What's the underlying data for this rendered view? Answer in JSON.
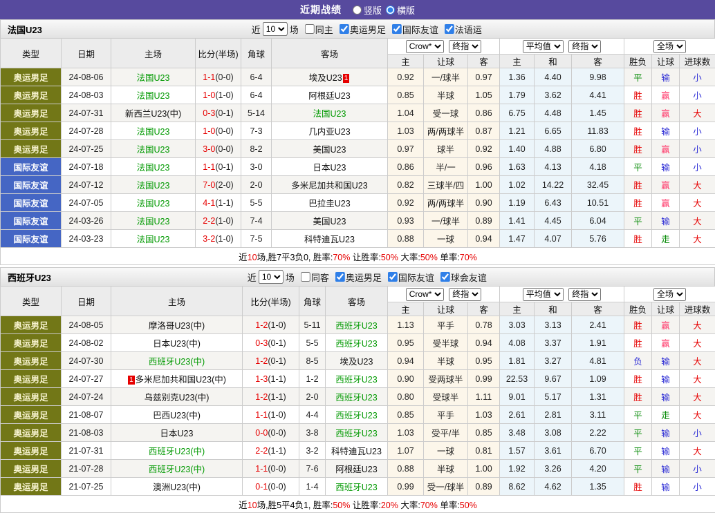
{
  "topbar": {
    "title": "近期战绩",
    "vertical_label": "竖版",
    "horizontal_label": "横版"
  },
  "colors": {
    "header_purple": "#574a9e",
    "type_olympic_olive": "#727717",
    "type_friendly_blue": "#4566c4",
    "team_green": "#009900",
    "win_red": "#e60000",
    "handicap_win_pink": "#ff3366",
    "lose_blue": "#2b2bd5",
    "draw_green": "#008800"
  },
  "sections": [
    {
      "team": "法国U23",
      "filter": {
        "near": "近",
        "games": "10",
        "unit": "场",
        "same": "同主",
        "types": [
          "奥运男足",
          "国际友谊",
          "法语运"
        ]
      },
      "selects": {
        "odds": "Crow*",
        "odds_final": "终指",
        "avg": "平均值",
        "avg_final": "终指",
        "scope": "全场"
      },
      "columns": [
        "类型",
        "日期",
        "主场",
        "比分(半场)",
        "角球",
        "客场",
        "主",
        "让球",
        "客",
        "主",
        "和",
        "客",
        "胜负",
        "让球",
        "进球数"
      ],
      "rows": [
        {
          "t": "奥运男足",
          "tc": "olive",
          "d": "24-08-06",
          "h": "法国U23",
          "hg": true,
          "hb": "",
          "s": "1-1",
          "sh": "(0-0)",
          "c": "6-4",
          "a": "埃及U23",
          "ag": false,
          "ab": "1",
          "o1": "0.92",
          "hc": "一/球半",
          "o2": "0.97",
          "v1": "1.36",
          "v2": "4.40",
          "v3": "9.98",
          "r1": [
            "平",
            "g"
          ],
          "r2": [
            "输",
            "b"
          ],
          "r3": [
            "小",
            "b"
          ]
        },
        {
          "t": "奥运男足",
          "tc": "olive",
          "d": "24-08-03",
          "h": "法国U23",
          "hg": true,
          "hb": "",
          "s": "1-0",
          "sh": "(1-0)",
          "c": "6-4",
          "a": "阿根廷U23",
          "ag": false,
          "ab": "",
          "o1": "0.85",
          "hc": "半球",
          "o2": "1.05",
          "v1": "1.79",
          "v2": "3.62",
          "v3": "4.41",
          "r1": [
            "胜",
            "r"
          ],
          "r2": [
            "赢",
            "p"
          ],
          "r3": [
            "小",
            "b"
          ]
        },
        {
          "t": "奥运男足",
          "tc": "olive",
          "d": "24-07-31",
          "h": "新西兰U23(中)",
          "hg": false,
          "hb": "",
          "s": "0-3",
          "sh": "(0-1)",
          "c": "5-14",
          "a": "法国U23",
          "ag": true,
          "ab": "",
          "o1": "1.04",
          "hc": "受一球",
          "o2": "0.86",
          "v1": "6.75",
          "v2": "4.48",
          "v3": "1.45",
          "r1": [
            "胜",
            "r"
          ],
          "r2": [
            "赢",
            "p"
          ],
          "r3": [
            "大",
            "r"
          ]
        },
        {
          "t": "奥运男足",
          "tc": "olive",
          "d": "24-07-28",
          "h": "法国U23",
          "hg": true,
          "hb": "",
          "s": "1-0",
          "sh": "(0-0)",
          "c": "7-3",
          "a": "几内亚U23",
          "ag": false,
          "ab": "",
          "o1": "1.03",
          "hc": "两/两球半",
          "o2": "0.87",
          "v1": "1.21",
          "v2": "6.65",
          "v3": "11.83",
          "r1": [
            "胜",
            "r"
          ],
          "r2": [
            "输",
            "b"
          ],
          "r3": [
            "小",
            "b"
          ]
        },
        {
          "t": "奥运男足",
          "tc": "olive",
          "d": "24-07-25",
          "h": "法国U23",
          "hg": true,
          "hb": "",
          "s": "3-0",
          "sh": "(0-0)",
          "c": "8-2",
          "a": "美国U23",
          "ag": false,
          "ab": "",
          "o1": "0.97",
          "hc": "球半",
          "o2": "0.92",
          "v1": "1.40",
          "v2": "4.88",
          "v3": "6.80",
          "r1": [
            "胜",
            "r"
          ],
          "r2": [
            "赢",
            "p"
          ],
          "r3": [
            "小",
            "b"
          ]
        },
        {
          "t": "国际友谊",
          "tc": "blue",
          "d": "24-07-18",
          "h": "法国U23",
          "hg": true,
          "hb": "",
          "s": "1-1",
          "sh": "(0-1)",
          "c": "3-0",
          "a": "日本U23",
          "ag": false,
          "ab": "",
          "o1": "0.86",
          "hc": "半/一",
          "o2": "0.96",
          "v1": "1.63",
          "v2": "4.13",
          "v3": "4.18",
          "r1": [
            "平",
            "g"
          ],
          "r2": [
            "输",
            "b"
          ],
          "r3": [
            "小",
            "b"
          ]
        },
        {
          "t": "国际友谊",
          "tc": "blue",
          "d": "24-07-12",
          "h": "法国U23",
          "hg": true,
          "hb": "",
          "s": "7-0",
          "sh": "(2-0)",
          "c": "2-0",
          "a": "多米尼加共和国U23",
          "ag": false,
          "ab": "",
          "o1": "0.82",
          "hc": "三球半/四",
          "o2": "1.00",
          "v1": "1.02",
          "v2": "14.22",
          "v3": "32.45",
          "r1": [
            "胜",
            "r"
          ],
          "r2": [
            "赢",
            "p"
          ],
          "r3": [
            "大",
            "r"
          ]
        },
        {
          "t": "国际友谊",
          "tc": "blue",
          "d": "24-07-05",
          "h": "法国U23",
          "hg": true,
          "hb": "",
          "s": "4-1",
          "sh": "(1-1)",
          "c": "5-5",
          "a": "巴拉圭U23",
          "ag": false,
          "ab": "",
          "o1": "0.92",
          "hc": "两/两球半",
          "o2": "0.90",
          "v1": "1.19",
          "v2": "6.43",
          "v3": "10.51",
          "r1": [
            "胜",
            "r"
          ],
          "r2": [
            "赢",
            "p"
          ],
          "r3": [
            "大",
            "r"
          ]
        },
        {
          "t": "国际友谊",
          "tc": "blue",
          "d": "24-03-26",
          "h": "法国U23",
          "hg": true,
          "hb": "",
          "s": "2-2",
          "sh": "(1-0)",
          "c": "7-4",
          "a": "美国U23",
          "ag": false,
          "ab": "",
          "o1": "0.93",
          "hc": "一/球半",
          "o2": "0.89",
          "v1": "1.41",
          "v2": "4.45",
          "v3": "6.04",
          "r1": [
            "平",
            "g"
          ],
          "r2": [
            "输",
            "b"
          ],
          "r3": [
            "大",
            "r"
          ]
        },
        {
          "t": "国际友谊",
          "tc": "blue",
          "d": "24-03-23",
          "h": "法国U23",
          "hg": true,
          "hb": "",
          "s": "3-2",
          "sh": "(1-0)",
          "c": "7-5",
          "a": "科特迪瓦U23",
          "ag": false,
          "ab": "",
          "o1": "0.88",
          "hc": "一球",
          "o2": "0.94",
          "v1": "1.47",
          "v2": "4.07",
          "v3": "5.76",
          "r1": [
            "胜",
            "r"
          ],
          "r2": [
            "走",
            "g"
          ],
          "r3": [
            "大",
            "r"
          ]
        }
      ],
      "summary": [
        [
          "近",
          "k"
        ],
        [
          "10",
          "r"
        ],
        [
          "场,胜7平3负0, 胜率:",
          "k"
        ],
        [
          "70%",
          "r"
        ],
        [
          " 让胜率:",
          "k"
        ],
        [
          "50%",
          "r"
        ],
        [
          " 大率:",
          "k"
        ],
        [
          "50%",
          "r"
        ],
        [
          " 单率:",
          "k"
        ],
        [
          "70%",
          "r"
        ]
      ]
    },
    {
      "team": "西班牙U23",
      "filter": {
        "near": "近",
        "games": "10",
        "unit": "场",
        "same": "同客",
        "types": [
          "奥运男足",
          "国际友谊",
          "球会友谊"
        ]
      },
      "selects": {
        "odds": "Crow*",
        "odds_final": "终指",
        "avg": "平均值",
        "avg_final": "终指",
        "scope": "全场"
      },
      "columns": [
        "类型",
        "日期",
        "主场",
        "比分(半场)",
        "角球",
        "客场",
        "主",
        "让球",
        "客",
        "主",
        "和",
        "客",
        "胜负",
        "让球",
        "进球数"
      ],
      "rows": [
        {
          "t": "奥运男足",
          "tc": "olive",
          "d": "24-08-05",
          "h": "摩洛哥U23(中)",
          "hg": false,
          "hb": "",
          "s": "1-2",
          "sh": "(1-0)",
          "c": "5-11",
          "a": "西班牙U23",
          "ag": true,
          "ab": "",
          "o1": "1.13",
          "hc": "平手",
          "o2": "0.78",
          "v1": "3.03",
          "v2": "3.13",
          "v3": "2.41",
          "r1": [
            "胜",
            "r"
          ],
          "r2": [
            "赢",
            "p"
          ],
          "r3": [
            "大",
            "r"
          ]
        },
        {
          "t": "奥运男足",
          "tc": "olive",
          "d": "24-08-02",
          "h": "日本U23(中)",
          "hg": false,
          "hb": "",
          "s": "0-3",
          "sh": "(0-1)",
          "c": "5-5",
          "a": "西班牙U23",
          "ag": true,
          "ab": "",
          "o1": "0.95",
          "hc": "受半球",
          "o2": "0.94",
          "v1": "4.08",
          "v2": "3.37",
          "v3": "1.91",
          "r1": [
            "胜",
            "r"
          ],
          "r2": [
            "赢",
            "p"
          ],
          "r3": [
            "大",
            "r"
          ]
        },
        {
          "t": "奥运男足",
          "tc": "olive",
          "d": "24-07-30",
          "h": "西班牙U23(中)",
          "hg": true,
          "hb": "",
          "s": "1-2",
          "sh": "(0-1)",
          "c": "8-5",
          "a": "埃及U23",
          "ag": false,
          "ab": "",
          "o1": "0.94",
          "hc": "半球",
          "o2": "0.95",
          "v1": "1.81",
          "v2": "3.27",
          "v3": "4.81",
          "r1": [
            "负",
            "b"
          ],
          "r2": [
            "输",
            "b"
          ],
          "r3": [
            "大",
            "r"
          ]
        },
        {
          "t": "奥运男足",
          "tc": "olive",
          "d": "24-07-27",
          "h": "多米尼加共和国U23(中)",
          "hg": false,
          "hb": "1",
          "s": "1-3",
          "sh": "(1-1)",
          "c": "1-2",
          "a": "西班牙U23",
          "ag": true,
          "ab": "",
          "o1": "0.90",
          "hc": "受两球半",
          "o2": "0.99",
          "v1": "22.53",
          "v2": "9.67",
          "v3": "1.09",
          "r1": [
            "胜",
            "r"
          ],
          "r2": [
            "输",
            "b"
          ],
          "r3": [
            "大",
            "r"
          ]
        },
        {
          "t": "奥运男足",
          "tc": "olive",
          "d": "24-07-24",
          "h": "乌兹别克U23(中)",
          "hg": false,
          "hb": "",
          "s": "1-2",
          "sh": "(1-1)",
          "c": "2-0",
          "a": "西班牙U23",
          "ag": true,
          "ab": "",
          "o1": "0.80",
          "hc": "受球半",
          "o2": "1.11",
          "v1": "9.01",
          "v2": "5.17",
          "v3": "1.31",
          "r1": [
            "胜",
            "r"
          ],
          "r2": [
            "输",
            "b"
          ],
          "r3": [
            "大",
            "r"
          ]
        },
        {
          "t": "奥运男足",
          "tc": "olive",
          "d": "21-08-07",
          "h": "巴西U23(中)",
          "hg": false,
          "hb": "",
          "s": "1-1",
          "sh": "(1-0)",
          "c": "4-4",
          "a": "西班牙U23",
          "ag": true,
          "ab": "",
          "o1": "0.85",
          "hc": "平手",
          "o2": "1.03",
          "v1": "2.61",
          "v2": "2.81",
          "v3": "3.11",
          "r1": [
            "平",
            "g"
          ],
          "r2": [
            "走",
            "g"
          ],
          "r3": [
            "大",
            "r"
          ]
        },
        {
          "t": "奥运男足",
          "tc": "olive",
          "d": "21-08-03",
          "h": "日本U23",
          "hg": false,
          "hb": "",
          "s": "0-0",
          "sh": "(0-0)",
          "c": "3-8",
          "a": "西班牙U23",
          "ag": true,
          "ab": "",
          "o1": "1.03",
          "hc": "受平/半",
          "o2": "0.85",
          "v1": "3.48",
          "v2": "3.08",
          "v3": "2.22",
          "r1": [
            "平",
            "g"
          ],
          "r2": [
            "输",
            "b"
          ],
          "r3": [
            "小",
            "b"
          ]
        },
        {
          "t": "奥运男足",
          "tc": "olive",
          "d": "21-07-31",
          "h": "西班牙U23(中)",
          "hg": true,
          "hb": "",
          "s": "2-2",
          "sh": "(1-1)",
          "c": "3-2",
          "a": "科特迪瓦U23",
          "ag": false,
          "ab": "",
          "o1": "1.07",
          "hc": "一球",
          "o2": "0.81",
          "v1": "1.57",
          "v2": "3.61",
          "v3": "6.70",
          "r1": [
            "平",
            "g"
          ],
          "r2": [
            "输",
            "b"
          ],
          "r3": [
            "大",
            "r"
          ]
        },
        {
          "t": "奥运男足",
          "tc": "olive",
          "d": "21-07-28",
          "h": "西班牙U23(中)",
          "hg": true,
          "hb": "",
          "s": "1-1",
          "sh": "(0-0)",
          "c": "7-6",
          "a": "阿根廷U23",
          "ag": false,
          "ab": "",
          "o1": "0.88",
          "hc": "半球",
          "o2": "1.00",
          "v1": "1.92",
          "v2": "3.26",
          "v3": "4.20",
          "r1": [
            "平",
            "g"
          ],
          "r2": [
            "输",
            "b"
          ],
          "r3": [
            "小",
            "b"
          ]
        },
        {
          "t": "奥运男足",
          "tc": "olive",
          "d": "21-07-25",
          "h": "澳洲U23(中)",
          "hg": false,
          "hb": "",
          "s": "0-1",
          "sh": "(0-0)",
          "c": "1-4",
          "a": "西班牙U23",
          "ag": true,
          "ab": "",
          "o1": "0.99",
          "hc": "受一/球半",
          "o2": "0.89",
          "v1": "8.62",
          "v2": "4.62",
          "v3": "1.35",
          "r1": [
            "胜",
            "r"
          ],
          "r2": [
            "输",
            "b"
          ],
          "r3": [
            "小",
            "b"
          ]
        }
      ],
      "summary": [
        [
          "近",
          "k"
        ],
        [
          "10",
          "r"
        ],
        [
          "场,胜5平4负1, 胜率:",
          "k"
        ],
        [
          "50%",
          "r"
        ],
        [
          " 让胜率:",
          "k"
        ],
        [
          "20%",
          "r"
        ],
        [
          " 大率:",
          "k"
        ],
        [
          "70%",
          "r"
        ],
        [
          " 单率:",
          "k"
        ],
        [
          "50%",
          "r"
        ]
      ]
    }
  ]
}
